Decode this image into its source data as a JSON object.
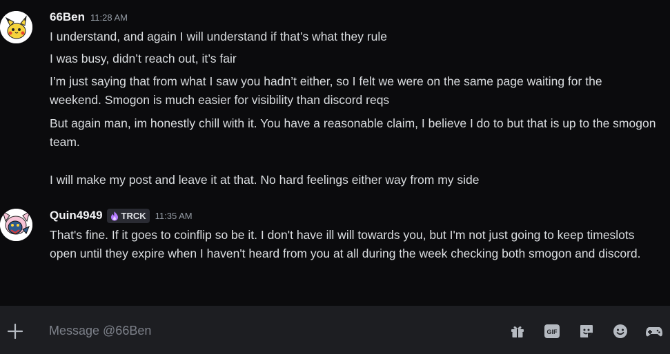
{
  "messages": [
    {
      "username": "66Ben",
      "timestamp": "11:28 AM",
      "avatar_icon": "pikachu-avatar",
      "lines": [
        "I understand, and again I will understand if that’s what they rule",
        "I was busy, didn’t reach out, it’s fair",
        "I’m just saying that from what I saw you hadn’t either, so I felt we were on the same page waiting for the weekend. Smogon is much easier for visibility than discord reqs",
        "But again man, im honestly chill with it. You have a reasonable claim, I believe I do to but that is up to the smogon team.",
        "I will make my post and leave it at that. No hard feelings either way from my side"
      ]
    },
    {
      "username": "Quin4949",
      "timestamp": "11:35 AM",
      "avatar_icon": "cat-creature-avatar",
      "tag": {
        "icon": "purple-flame-icon",
        "text": "TRCK"
      },
      "lines": [
        "That's fine. If it goes to coinflip so be it. I don't have ill will towards you, but I'm not just going to keep timeslots open until they expire when I haven't heard from you at all during the week checking both smogon and discord."
      ]
    }
  ],
  "composer": {
    "placeholder": "Message @66Ben",
    "gif_label": "GIF",
    "icons": [
      "plus-icon",
      "gift-icon",
      "gif-icon",
      "sticker-icon",
      "emoji-icon",
      "gamepad-icon"
    ]
  },
  "colors": {
    "background": "#0b0b0d",
    "composer": "#1d1e22",
    "text": "#dbdee1",
    "muted": "#949ba4",
    "tag_accent": "#b57bff"
  }
}
